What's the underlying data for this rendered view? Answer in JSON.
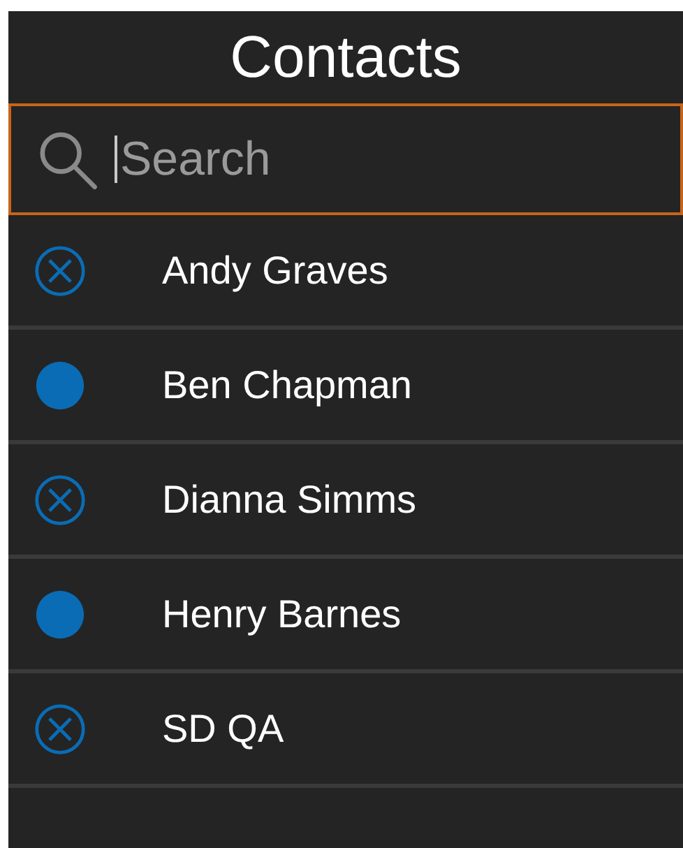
{
  "title": "Contacts",
  "search": {
    "placeholder": "Search"
  },
  "contacts": [
    {
      "name": "Andy Graves",
      "available": false
    },
    {
      "name": "Ben Chapman",
      "available": true
    },
    {
      "name": "Dianna Simms",
      "available": false
    },
    {
      "name": "Henry Barnes",
      "available": true
    },
    {
      "name": "SD QA",
      "available": false
    }
  ]
}
